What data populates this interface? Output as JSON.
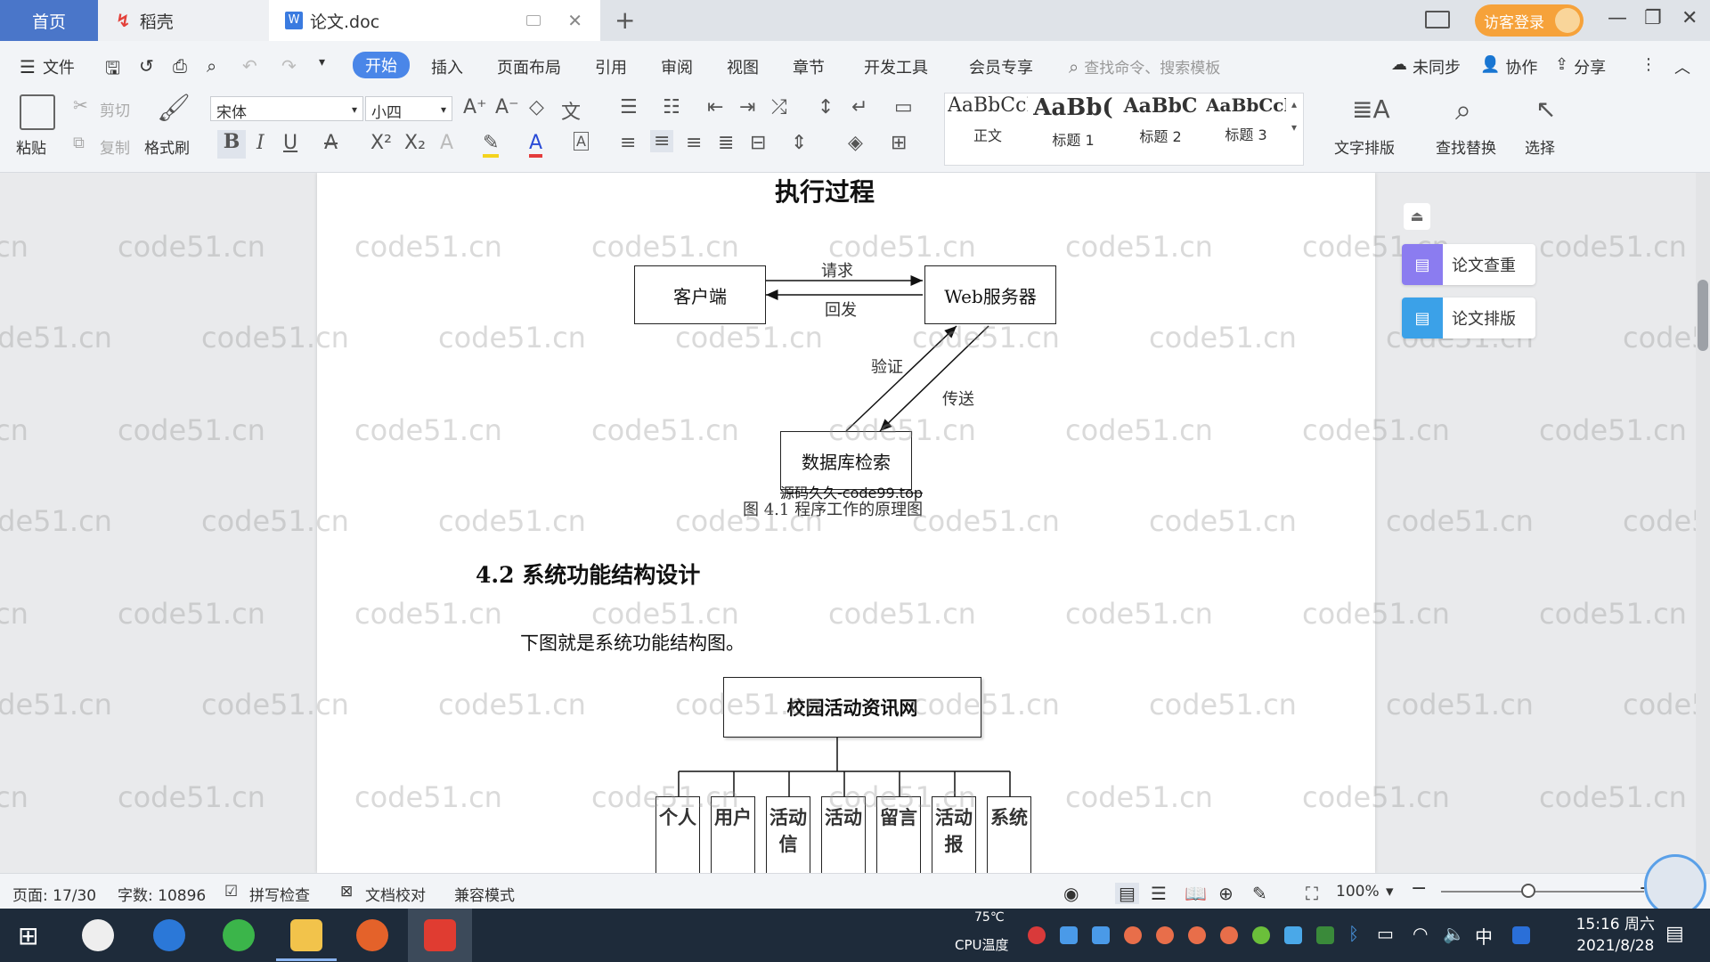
{
  "tabs": {
    "home": "首页",
    "daoke": "稻壳",
    "doc": "论文.doc",
    "new_tab": "+",
    "close": "✕"
  },
  "account": {
    "visitor_login": "访客登录"
  },
  "window": {
    "minimize": "—",
    "restore": "❐",
    "close": "✕"
  },
  "menu": {
    "file": "文件",
    "items": [
      "开始",
      "插入",
      "页面布局",
      "引用",
      "审阅",
      "视图",
      "章节",
      "开发工具",
      "会员专享"
    ],
    "search_placeholder": "查找命令、搜索模板",
    "unsynced": "未同步",
    "collaborate": "协作",
    "share": "分享"
  },
  "ribbon": {
    "paste": "粘贴",
    "cut": "剪切",
    "copy": "复制",
    "format_painter": "格式刷",
    "font_name": "宋体",
    "font_size": "小四",
    "styles": [
      {
        "sample": "AaBbCcI",
        "name": "正文"
      },
      {
        "sample": "AaBb(",
        "name": "标题 1"
      },
      {
        "sample": "AaBbC",
        "name": "标题 2"
      },
      {
        "sample": "AaBbCcl",
        "name": "标题 3"
      }
    ],
    "text_layout": "文字排版",
    "find_replace": "查找替换",
    "select": "选择"
  },
  "document": {
    "heading_top": "执行过程",
    "diagram1": {
      "client": "客户端",
      "web_server": "Web服务器",
      "db_search": "数据库检索",
      "request": "请求",
      "reply": "回发",
      "verify": "验证",
      "transmit": "传送",
      "source_mark": "源码久久-code99.top",
      "caption": "图 4.1  程序工作的原理图"
    },
    "section_title": "4.2 系统功能结构设计",
    "paragraph": "下图就是系统功能结构图。",
    "diagram2": {
      "root": "校园活动资讯网",
      "children": [
        "个人",
        "用户",
        "活动信",
        "活动",
        "留言",
        "活动报",
        "系统"
      ]
    },
    "watermark": "code51.cn"
  },
  "side_panel": {
    "check": "论文查重",
    "layout": "论文排版"
  },
  "status": {
    "page": "页面: 17/30",
    "words": "字数: 10896",
    "spell": "拼写检查",
    "proof": "文档校对",
    "compat": "兼容模式",
    "zoom": "100%"
  },
  "taskbar": {
    "cpu_temp": "75℃",
    "cpu_label": "CPU温度",
    "ime": "中",
    "time": "15:16 周六",
    "date": "2021/8/28"
  },
  "colors": {
    "accent": "#4a86e8",
    "visitor": "#f6a23a",
    "taskbar": "#1e2b3a"
  }
}
